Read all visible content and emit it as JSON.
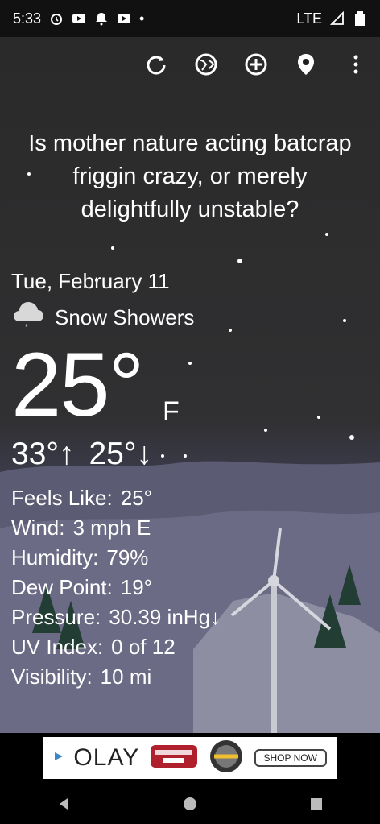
{
  "status_bar": {
    "time": "5:33",
    "network": "LTE"
  },
  "toolbar": {
    "icons": [
      "refresh-icon",
      "globe-icon",
      "add-icon",
      "location-icon",
      "more-vert-icon"
    ]
  },
  "headline": "Is mother nature acting batcrap friggin crazy, or merely delightfully unstable?",
  "weather": {
    "date": "Tue, February 11",
    "condition": "Snow Showers",
    "temperature": "25°",
    "unit": "F",
    "high": "33°↑",
    "low": "25°↓"
  },
  "details": [
    {
      "label": "Feels Like:",
      "value": "25°"
    },
    {
      "label": "Wind:",
      "value": "3 mph E"
    },
    {
      "label": "Humidity:",
      "value": "79%"
    },
    {
      "label": "Dew Point:",
      "value": "19°"
    },
    {
      "label": "Pressure:",
      "value": "30.39 inHg↓"
    },
    {
      "label": "UV Index:",
      "value": "0 of 12"
    },
    {
      "label": "Visibility:",
      "value": "10 mi"
    }
  ],
  "ad": {
    "brand": "OLAY",
    "cta": "SHOP NOW"
  },
  "colors": {
    "status_bar_bg": "#111111",
    "scene_top": "#2a2a2a",
    "text": "#ffffff",
    "ad_bg": "#ffffff"
  }
}
